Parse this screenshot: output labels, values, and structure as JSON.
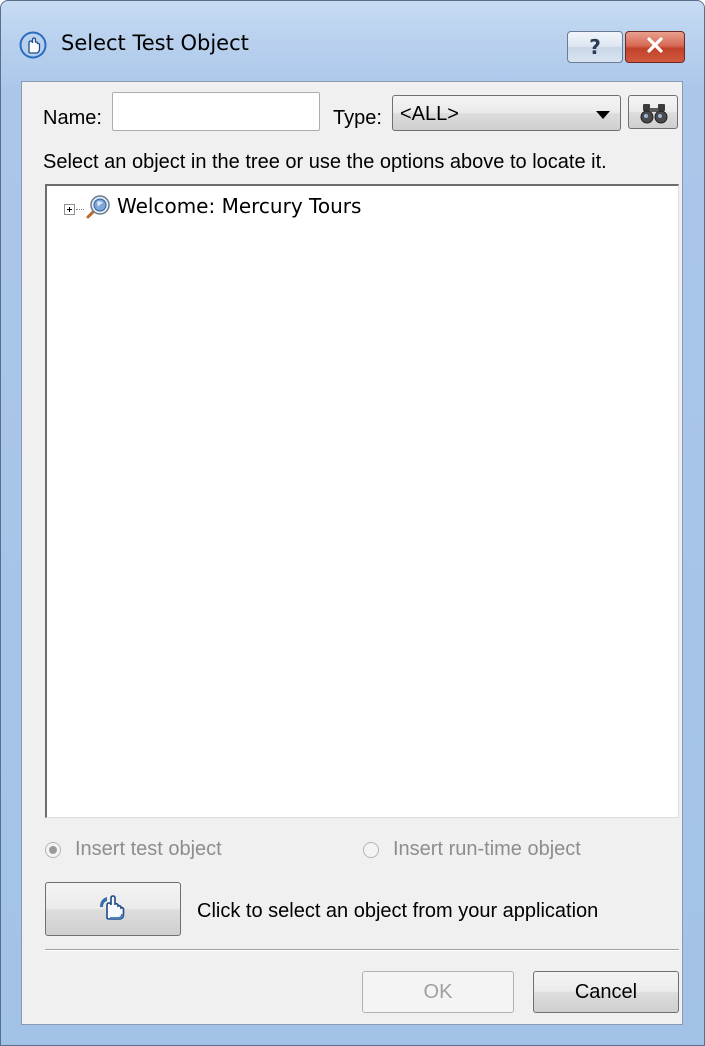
{
  "window": {
    "title": "Select Test Object",
    "title_icon": "pointing-hand-icon",
    "help_label": "?",
    "close_icon": "close-icon"
  },
  "search": {
    "name_label": "Name:",
    "name_value": "",
    "type_label": "Type:",
    "type_value": "<ALL>",
    "find_icon": "binoculars-icon",
    "hint": "Select an object in the tree or use the options above to locate it."
  },
  "tree": {
    "items": [
      {
        "label": "Welcome: Mercury Tours",
        "icon": "browser-object-icon",
        "expanded": false
      }
    ]
  },
  "options": {
    "insert_test_object": "Insert test object",
    "insert_runtime_object": "Insert run-time object",
    "insert_test_object_selected": true
  },
  "pointer": {
    "icon": "pointing-hand-icon",
    "caption": "Click to select an object from your application"
  },
  "footer": {
    "ok_label": "OK",
    "cancel_label": "Cancel"
  },
  "colors": {
    "frame": "#aac7ea",
    "client": "#f0f0f0",
    "close_button": "#c2422b"
  }
}
